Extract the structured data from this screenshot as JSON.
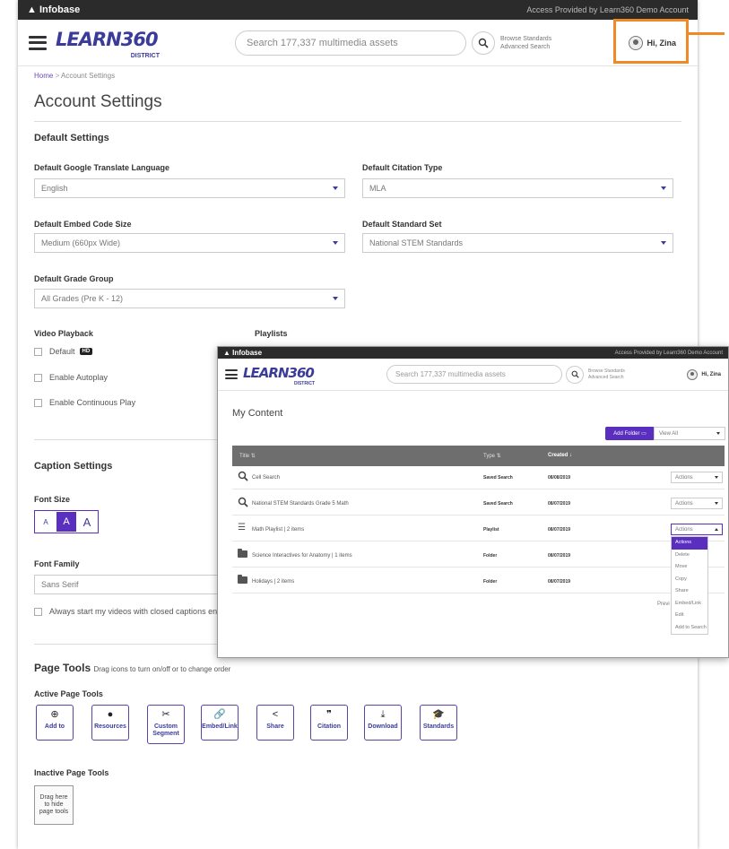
{
  "topbar": {
    "brand": "Infobase",
    "access": "Access Provided by Learn360 Demo Account"
  },
  "header": {
    "logo_text": "LEARN360",
    "logo_tag": "DISTRICT",
    "search_placeholder": "Search 177,337 multimedia assets",
    "browse_standards": "Browse Standards",
    "advanced_search": "Advanced Search",
    "greeting": "Hi, Zina"
  },
  "breadcrumb": {
    "home": "Home",
    "separator": ">",
    "current": "Account Settings"
  },
  "page_title": "Account Settings",
  "default_settings": {
    "heading": "Default Settings",
    "google_translate": {
      "label": "Default Google Translate Language",
      "value": "English"
    },
    "citation_type": {
      "label": "Default Citation Type",
      "value": "MLA"
    },
    "embed_size": {
      "label": "Default Embed Code Size",
      "value": "Medium (660px Wide)"
    },
    "standard_set": {
      "label": "Default Standard Set",
      "value": "National STEM Standards"
    },
    "grade_group": {
      "label": "Default Grade Group",
      "value": "All Grades (Pre K - 12)"
    }
  },
  "video_playback": {
    "heading": "Video Playback",
    "default_label": "Default",
    "hd_badge": "HD",
    "autoplay_label": "Enable Autoplay",
    "continuous_label": "Enable Continuous Play"
  },
  "playlists": {
    "heading": "Playlists"
  },
  "caption_settings": {
    "heading": "Caption Settings",
    "font_size_label": "Font Size",
    "font_sizes": [
      "A",
      "A",
      "A"
    ],
    "font_family_label": "Font Family",
    "font_family_value": "Sans Serif",
    "always_cc_label": "Always start my videos with closed captions ena"
  },
  "page_tools": {
    "heading": "Page Tools",
    "hint": "Drag icons to turn on/off or to change order",
    "active_label": "Active Page Tools",
    "active": [
      {
        "label": "Add to",
        "icon": "⊕"
      },
      {
        "label": "Resources",
        "icon": "●"
      },
      {
        "label": "Custom Segment",
        "icon": "✂"
      },
      {
        "label": "Embed/Link",
        "icon": "🔗"
      },
      {
        "label": "Share",
        "icon": "<"
      },
      {
        "label": "Citation",
        "icon": "❞"
      },
      {
        "label": "Download",
        "icon": "⤓"
      },
      {
        "label": "Standards",
        "icon": "🎓"
      }
    ],
    "inactive_label": "Inactive Page Tools",
    "inactive_hint": "Drag here to hide page tools"
  },
  "overlay": {
    "topbar": {
      "brand": "Infobase",
      "access": "Access Provided by Learn360 Demo Account"
    },
    "search_placeholder": "Search 177,337 multimedia assets",
    "browse_standards": "Browse Standards",
    "advanced_search": "Advanced Search",
    "greeting": "Hi, Zina",
    "title": "My Content",
    "add_folder": "Add Folder",
    "view_all": "View All",
    "columns": {
      "title": "Title ⇅",
      "type": "Type ⇅",
      "created": "Created ↓"
    },
    "rows": [
      {
        "title": "Cell Search",
        "type": "Saved Search",
        "date": "08/08/2019",
        "icon": "search",
        "actions": "Actions"
      },
      {
        "title": "National STEM Standards Grade 5 Math",
        "type": "Saved Search",
        "date": "08/07/2019",
        "icon": "search",
        "actions": "Actions"
      },
      {
        "title": "Math Playlist | 2 items",
        "type": "Playlist",
        "date": "08/07/2019",
        "icon": "playlist",
        "actions": "Actions"
      },
      {
        "title": "Science Interactives for Anatomy | 1 items",
        "type": "Folder",
        "date": "08/07/2019",
        "icon": "folder",
        "actions": ""
      },
      {
        "title": "Holidays | 2 items",
        "type": "Folder",
        "date": "08/07/2019",
        "icon": "folder",
        "actions": ""
      }
    ],
    "menu": [
      "Actions",
      "Delete",
      "Move",
      "Copy",
      "Share",
      "Embed/Link",
      "Edit",
      "Add to Search"
    ],
    "prev_text": "Previ"
  },
  "colors": {
    "accent": "#5a2fbf",
    "brand": "#3b3c9a",
    "highlight": "#f08a24",
    "topbar": "#2b2b2b"
  }
}
